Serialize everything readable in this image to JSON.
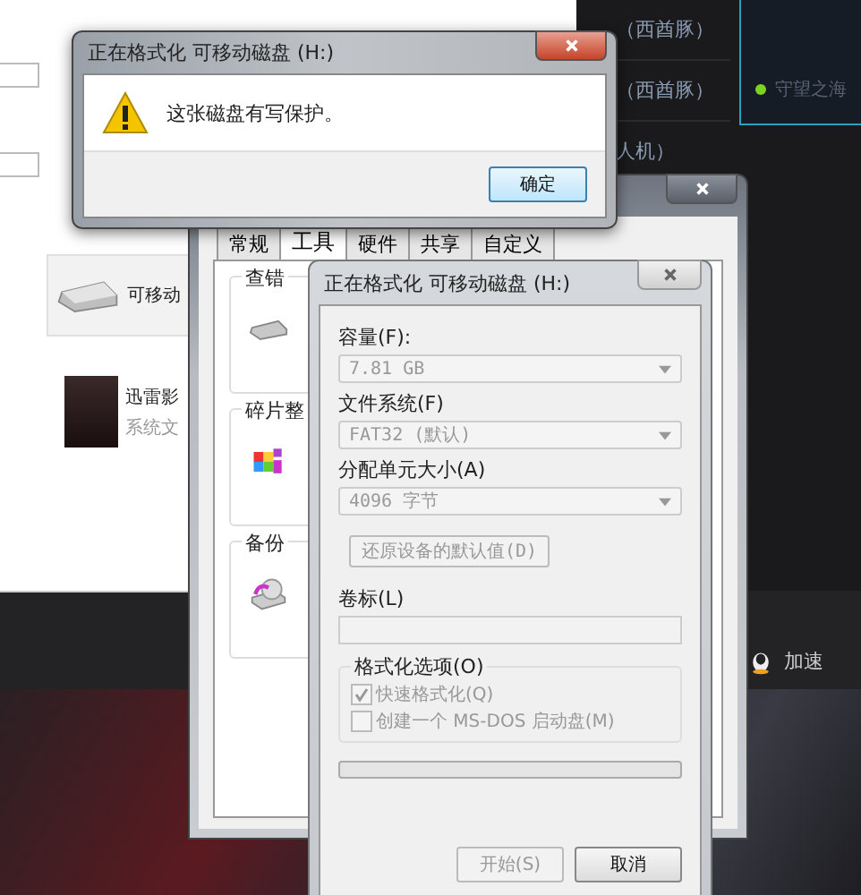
{
  "explorer_window": {
    "items": [
      {
        "kind": "drive",
        "name": "可移动"
      },
      {
        "kind": "app",
        "name": "迅雷影",
        "subtitle": "系统文"
      }
    ]
  },
  "game_client": {
    "rows": [
      {
        "text": "（西酋豚）"
      },
      {
        "text": "（西酋豚）"
      },
      {
        "text": "人机）"
      }
    ],
    "server": {
      "name": "守望之海"
    },
    "speedup": "加速"
  },
  "properties_window": {
    "tabs": [
      {
        "label": "常规",
        "selected": false
      },
      {
        "label": "工具",
        "selected": true
      },
      {
        "label": "硬件",
        "selected": false
      },
      {
        "label": "共享",
        "selected": false
      },
      {
        "label": "自定义",
        "selected": false
      }
    ],
    "groups": [
      {
        "kind": "check",
        "title": "查错"
      },
      {
        "kind": "defrag",
        "title": "碎片整"
      },
      {
        "kind": "backup",
        "title": "备份"
      }
    ]
  },
  "format_dialog": {
    "title": "正在格式化 可移动磁盘 (H:)",
    "dropdowns": [
      {
        "label": "容量(F):",
        "value": "7.81 GB",
        "disabled": true
      },
      {
        "label": "文件系统(F)",
        "value": "FAT32 (默认)",
        "disabled": true
      },
      {
        "label": "分配单元大小(A)",
        "value": "4096 字节",
        "disabled": true
      }
    ],
    "restore_button": {
      "label": "还原设备的默认值(D)",
      "disabled": true
    },
    "volume_label": {
      "label": "卷标(L)",
      "disabled": true
    },
    "options": {
      "title": "格式化选项(O)",
      "checkboxes": [
        {
          "label": "快速格式化(Q)",
          "checked": true,
          "disabled": true
        },
        {
          "label": "创建一个 MS-DOS 启动盘(M)",
          "checked": false,
          "disabled": true
        }
      ]
    },
    "progress": {
      "level": 0
    },
    "buttons": [
      {
        "label": "开始(S)",
        "disabled": true
      },
      {
        "label": "取消",
        "disabled": false
      }
    ]
  },
  "alert": {
    "title": "正在格式化 可移动磁盘 (H:)",
    "message": "这张磁盘有写保护。",
    "button": "确定"
  }
}
